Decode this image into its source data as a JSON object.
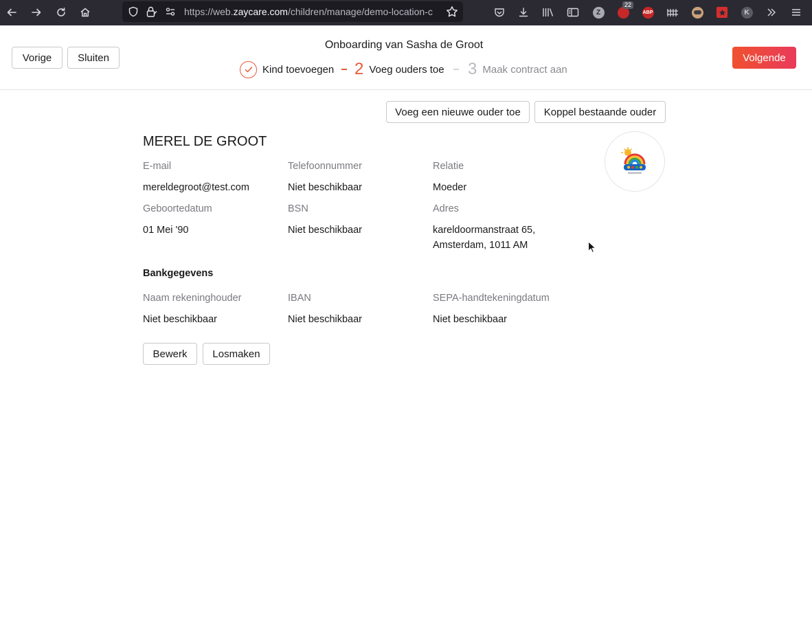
{
  "browser": {
    "url_prefix": "https://web.",
    "url_host": "zaycare.com",
    "url_path": "/children/manage/demo-location-c",
    "extensions": [
      {
        "name": "pocket-icon"
      },
      {
        "name": "download-icon"
      },
      {
        "name": "library-icon"
      },
      {
        "name": "reader-view-icon"
      },
      {
        "name": "zotero-icon",
        "letter": "Z",
        "color": "#a9a9b0"
      },
      {
        "name": "ublock-icon",
        "badge": "22",
        "color": "#c62828"
      },
      {
        "name": "adblock-plus-icon",
        "letter": "ABP",
        "color": "#c62828"
      },
      {
        "name": "containers-icon"
      },
      {
        "name": "privacy-badger-icon",
        "color": "#c9a27a"
      },
      {
        "name": "bookmark-star-icon",
        "color": "#d62e2e"
      },
      {
        "name": "account-icon",
        "letter": "K",
        "color": "#5a5a63"
      },
      {
        "name": "overflow-icon"
      },
      {
        "name": "menu-icon"
      }
    ]
  },
  "header": {
    "back_label": "Vorige",
    "close_label": "Sluiten",
    "title": "Onboarding van Sasha de Groot",
    "next_label": "Volgende",
    "steps": [
      {
        "number": "",
        "label": "Kind toevoegen",
        "state": "done"
      },
      {
        "number": "2",
        "label": "Voeg ouders toe",
        "state": "active"
      },
      {
        "number": "3",
        "label": "Maak contract aan",
        "state": "upcoming"
      }
    ]
  },
  "actions": {
    "add_parent_label": "Voeg een nieuwe ouder toe",
    "link_parent_label": "Koppel bestaande ouder"
  },
  "parent": {
    "name": "MEREL DE GROOT",
    "fields": {
      "email_label": "E-mail",
      "email_value": "mereldegroot@test.com",
      "phone_label": "Telefoonnummer",
      "phone_value": "Niet beschikbaar",
      "relation_label": "Relatie",
      "relation_value": "Moeder",
      "birthdate_label": "Geboortedatum",
      "birthdate_value": "01 Mei '90",
      "bsn_label": "BSN",
      "bsn_value": "Niet beschikbaar",
      "address_label": "Adres",
      "address_line1": "kareldoormanstraat 65,",
      "address_line2": "Amsterdam, 1011 AM"
    },
    "bank": {
      "title": "Bankgegevens",
      "holder_label": "Naam rekeninghouder",
      "holder_value": "Niet beschikbaar",
      "iban_label": "IBAN",
      "iban_value": "Niet beschikbaar",
      "sepa_label": "SEPA-handtekeningdatum",
      "sepa_value": "Niet beschikbaar"
    },
    "edit_label": "Bewerk",
    "unlink_label": "Losmaken"
  },
  "colors": {
    "accent": "#e8593a",
    "primary_gradient_start": "#f0512f",
    "primary_gradient_end": "#e93a5a",
    "browser_chrome": "#2b2a33"
  }
}
